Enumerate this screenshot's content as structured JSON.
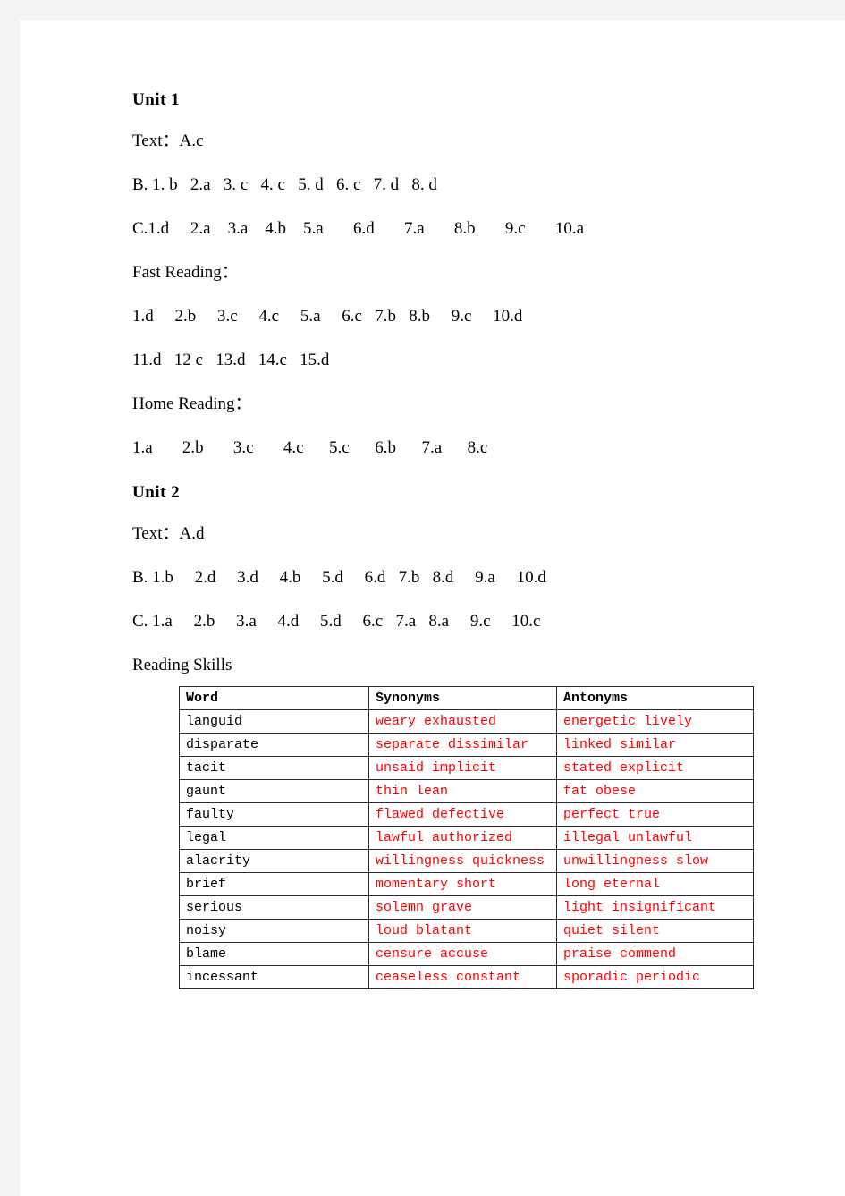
{
  "document": {
    "units": [
      {
        "heading": "Unit 1",
        "lines": [
          {
            "name": "unit1-text-line",
            "text": "Text：A.c"
          },
          {
            "name": "unit1-section-b-line",
            "text": "B. 1. b   2.a   3. c   4. c   5. d   6. c   7. d   8. d"
          },
          {
            "name": "unit1-section-c-line",
            "text": "C.1.d     2.a    3.a    4.b    5.a       6.d       7.a       8.b       9.c       10.a"
          },
          {
            "name": "unit1-fast-reading-label",
            "text": "Fast Reading："
          },
          {
            "name": "unit1-fast-reading-row1",
            "text": "1.d     2.b     3.c     4.c     5.a     6.c   7.b   8.b     9.c     10.d"
          },
          {
            "name": "unit1-fast-reading-row2",
            "text": "11.d   12 c   13.d   14.c   15.d"
          },
          {
            "name": "unit1-home-reading-label",
            "text": "Home Reading："
          },
          {
            "name": "unit1-home-reading-row1",
            "text": "1.a       2.b       3.c       4.c      5.c      6.b      7.a      8.c"
          }
        ]
      },
      {
        "heading": "Unit 2",
        "lines": [
          {
            "name": "unit2-text-line",
            "text": "Text：A.d"
          },
          {
            "name": "unit2-section-b-line",
            "text": "B. 1.b     2.d     3.d     4.b     5.d     6.d   7.b   8.d     9.a     10.d"
          },
          {
            "name": "unit2-section-c-line",
            "text": "C. 1.a     2.b     3.a     4.d     5.d     6.c   7.a   8.a     9.c     10.c"
          },
          {
            "name": "unit2-reading-skills-label",
            "text": "Reading Skills"
          }
        ]
      }
    ],
    "skills_table": {
      "columns": [
        "Word",
        "Synonyms",
        "Antonyms"
      ],
      "rows": [
        {
          "word": "languid",
          "synonyms": "weary exhausted",
          "antonyms": "energetic lively"
        },
        {
          "word": "disparate",
          "synonyms": "separate dissimilar",
          "antonyms": "linked similar"
        },
        {
          "word": "tacit",
          "synonyms": "unsaid implicit",
          "antonyms": "stated explicit"
        },
        {
          "word": "gaunt",
          "synonyms": "thin lean",
          "antonyms": "fat obese"
        },
        {
          "word": "faulty",
          "synonyms": "flawed defective",
          "antonyms": "perfect true"
        },
        {
          "word": "legal",
          "synonyms": "lawful authorized",
          "antonyms": "illegal unlawful"
        },
        {
          "word": "alacrity",
          "synonyms": "willingness quickness",
          "antonyms": "unwillingness slow"
        },
        {
          "word": "brief",
          "synonyms": "momentary short",
          "antonyms": "long eternal"
        },
        {
          "word": "serious",
          "synonyms": "solemn grave",
          "antonyms": "light insignificant"
        },
        {
          "word": "noisy",
          "synonyms": "loud blatant",
          "antonyms": "quiet silent"
        },
        {
          "word": "blame",
          "synonyms": "censure accuse",
          "antonyms": "praise commend"
        },
        {
          "word": "incessant",
          "synonyms": "ceaseless constant",
          "antonyms": "sporadic periodic"
        }
      ]
    },
    "colors": {
      "page_background": "#ffffff",
      "canvas_background": "#f4f4f4",
      "text": "#000000",
      "table_answer_text": "#ff0000",
      "table_border": "#2b2b2b"
    }
  }
}
